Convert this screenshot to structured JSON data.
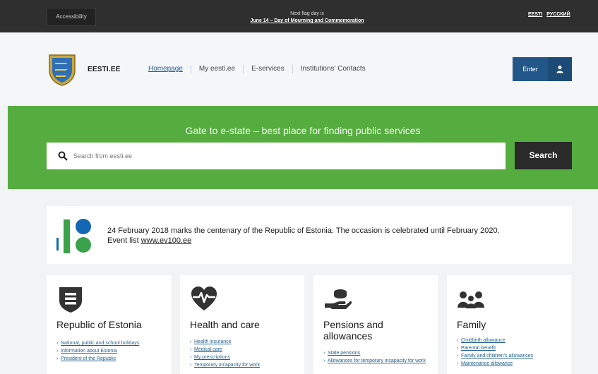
{
  "topbar": {
    "accessibility": "Accessibility",
    "flag_label": "Next flag day is",
    "flag_day": "June 14 – Day of Mourning and Commemoration",
    "langs": [
      "EESTI",
      "РУССКИЙ"
    ]
  },
  "header": {
    "brand": "EESTI.EE",
    "nav": [
      "Homepage",
      "My eesti.ee",
      "E-services",
      "Institutions' Contacts"
    ],
    "enter_label": "Enter"
  },
  "hero": {
    "title": "Gate to e-state – best place for finding public services",
    "search_placeholder": "Search from eesti.ee",
    "search_button": "Search"
  },
  "centenary": {
    "text": "24 February 2018 marks the centenary of the Republic of Estonia. The occasion is celebrated until February 2020.",
    "event_prefix": "Event list ",
    "event_link": "www.ev100.ee"
  },
  "cards": [
    {
      "title": "Republic of Estonia",
      "links": [
        "National, public and school holidays",
        "Information about Estonia",
        "President of the Republic"
      ]
    },
    {
      "title": "Health and care",
      "links": [
        "Health insurance",
        "Medical care",
        "My prescriptions",
        "Temporary incapacity for work"
      ]
    },
    {
      "title": "Pensions and allowances",
      "links": [
        "State pensions",
        "Allowances for temporary incapacity for work"
      ]
    },
    {
      "title": "Family",
      "links": [
        "Childbirth allowance",
        "Parental benefit",
        "Family and children's allowances",
        "Maintenance allowance"
      ]
    }
  ],
  "colors": {
    "topbar": "#2f2f2f",
    "hero_green": "#56ad3f",
    "enter_blue": "#23578a",
    "link_blue": "#1f5f8b",
    "ev_blue": "#1467b5",
    "ev_green": "#3aa24a"
  }
}
